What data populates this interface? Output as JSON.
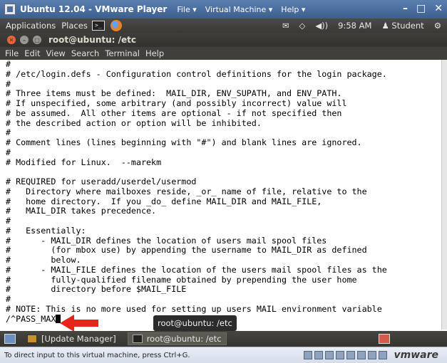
{
  "vmware": {
    "title": "Ubuntu 12.04 - VMware Player",
    "menu_file": "File ▾",
    "menu_vm": "Virtual Machine ▾",
    "menu_help": "Help ▾",
    "minimize": "–",
    "maximize": "□",
    "close": "✕",
    "status_text": "To direct input to this virtual machine, press Ctrl+G.",
    "brand": "vmware"
  },
  "ubuntu_panel": {
    "applications": "Applications",
    "places": "Places",
    "clock": "9:58 AM",
    "user": "Student",
    "mail_icon": "✉",
    "wifi_icon": "◇",
    "volume_icon": "◀))",
    "user_icon": "♟",
    "gear_icon": "⚙"
  },
  "terminal": {
    "window_title": "root@ubuntu: /etc",
    "menu": [
      "File",
      "Edit",
      "View",
      "Search",
      "Terminal",
      "Help"
    ],
    "lines": [
      "#",
      "# /etc/login.defs - Configuration control definitions for the login package.",
      "#",
      "# Three items must be defined:  MAIL_DIR, ENV_SUPATH, and ENV_PATH.",
      "# If unspecified, some arbitrary (and possibly incorrect) value will",
      "# be assumed.  All other items are optional - if not specified then",
      "# the described action or option will be inhibited.",
      "#",
      "# Comment lines (lines beginning with \"#\") and blank lines are ignored.",
      "#",
      "# Modified for Linux.  --marekm",
      "",
      "# REQUIRED for useradd/userdel/usermod",
      "#   Directory where mailboxes reside, _or_ name of file, relative to the",
      "#   home directory.  If you _do_ define MAIL_DIR and MAIL_FILE,",
      "#   MAIL_DIR takes precedence.",
      "#",
      "#   Essentially:",
      "#      - MAIL_DIR defines the location of users mail spool files",
      "#        (for mbox use) by appending the username to MAIL_DIR as defined",
      "#        below.",
      "#      - MAIL_FILE defines the location of the users mail spool files as the",
      "#        fully-qualified filename obtained by prepending the user home",
      "#        directory before $MAIL_FILE",
      "#",
      "# NOTE: This is no more used for setting up users MAIL environment variable"
    ],
    "search_prompt": "/^PASS_MAX",
    "tooltip": "root@ubuntu: /etc"
  },
  "taskbar": {
    "items": [
      "[Update Manager]",
      "root@ubuntu: /etc"
    ]
  },
  "colors": {
    "arrow": "#e8231c"
  }
}
